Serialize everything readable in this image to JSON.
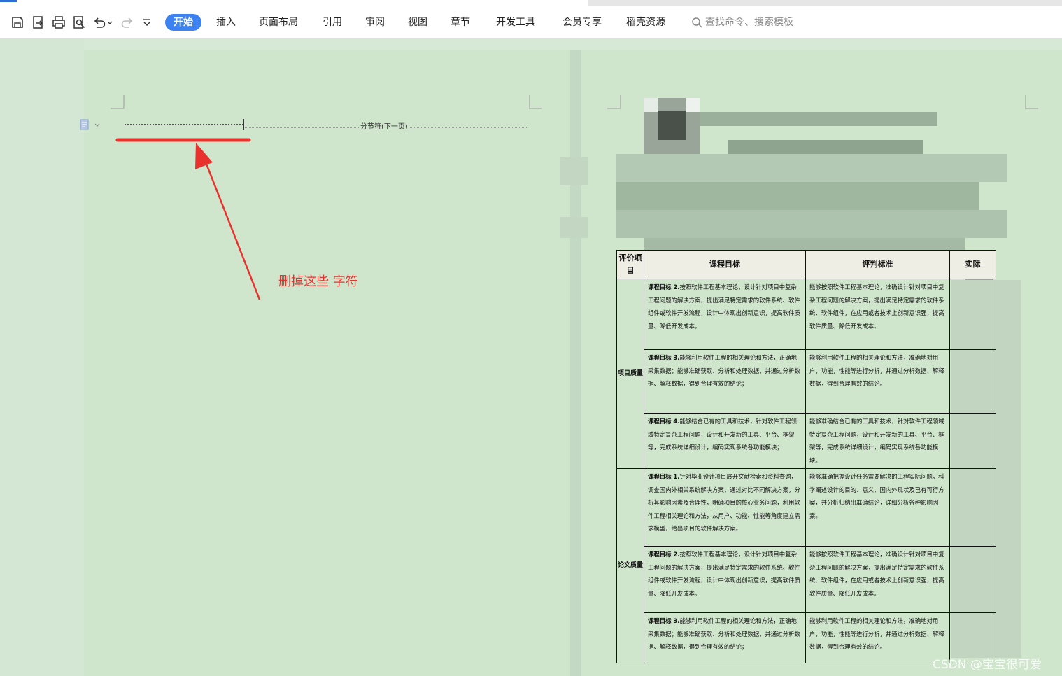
{
  "toolbar": {
    "icons": [
      "save-icon",
      "export-pdf-icon",
      "print-icon",
      "print-preview-icon",
      "undo-icon",
      "undo-dropdown-icon",
      "redo-icon",
      "more-dropdown-icon"
    ],
    "tabs": [
      "开始",
      "插入",
      "页面布局",
      "引用",
      "审阅",
      "视图",
      "章节",
      "开发工具",
      "会员专享",
      "稻壳资源"
    ],
    "active_tab": "开始",
    "search_placeholder": "查找命令、搜索模板",
    "accent_color": "#3c82f0"
  },
  "left_page": {
    "section_break_label": "分节符(下一页)",
    "annotation": "删掉这些 字符",
    "annotation_color": "#e8322e"
  },
  "right_page": {
    "table_headers": [
      "评价项目",
      "课程目标",
      "评判标准",
      "实际"
    ],
    "categories": [
      "项目质量",
      "论文质量"
    ],
    "rows": [
      {
        "tag": "课程目标 2.",
        "goal": "按照软件工程基本理论，设计针对项目中复杂工程问题的解决方案，提出满足特定需求的软件系统、软件组件或软件开发流程，设计中体现出创新意识，提高软件质量、降低开发成本。",
        "standard": "能够按照软件工程基本理论，准确设计针对项目中复杂工程问题的解决方案，提出满足特定需求的软件系统、软件组件，在应用或者技术上创新意识强，提高软件质量、降低开发成本。"
      },
      {
        "tag": "课程目标 3.",
        "goal": "能够利用软件工程的相关理论和方法，正确地采集数据；能够准确获取、分析和处理数据，并通过分析数据、解释数据，得到合理有效的结论；",
        "standard": "能够利用软件工程的相关理论和方法，准确地对用户，功能，性能等进行分析，并通过分析数据、解释数据，得到合理有效的结论。"
      },
      {
        "tag": "课程目标 4.",
        "goal": "能够结合已有的工具和技术，针对软件工程领域特定复杂工程问题，设计和开发新的工具、平台、框架等，完成系统详细设计，编码实现系统各功能模块；",
        "standard": "能够准确结合已有的工具和技术，针对软件工程领域特定复杂工程问题，设计和开发新的工具、平台、框架等，完成系统详细设计，编码实现系统各功能模块。"
      },
      {
        "tag": "课程目标 1.",
        "goal": "针对毕业设计项目展开文献检索和资料查询，调查国内外相关系统解决方案，通过对比不同解决方案，分析其影响因素及合理性，明确项目的核心业务问题，利用软件工程相关理论和方法，从用户、功能、性能等角度建立需求模型，给出项目的软件解决方案。",
        "standard": "能够准确把握设计任务需要解决的工程实际问题，科学阐述设计的目的、意义、国内外现状及已有可行方案，并分析归纳出准确结论，详细分析各种影响因素。"
      },
      {
        "tag": "课程目标 2.",
        "goal": "按照软件工程基本理论，设计针对项目中复杂工程问题的解决方案，提出满足特定需求的软件系统、软件组件或软件开发流程，设计中体现出创新意识，提高软件质量、降低开发成本。",
        "standard": "能够按照软件工程基本理论，准确设计针对项目中复杂工程问题的解决方案，提出满足特定需求的软件系统、软件组件，在应用或者技术上创新意识强，提高软件质量、降低开发成本。"
      },
      {
        "tag": "课程目标 3.",
        "goal": "能够利用软件工程的相关理论和方法，正确地采集数据；能够准确获取、分析和处理数据，并通过分析数据、解释数据，得到合理有效的结论；",
        "standard": "能够利用软件工程的相关理论和方法，准确地对用户，功能，性能等进行分析，并通过分析数据、解释数据，得到合理有效的结论。"
      }
    ]
  },
  "watermark": "CSDN @宝宝很可爱"
}
